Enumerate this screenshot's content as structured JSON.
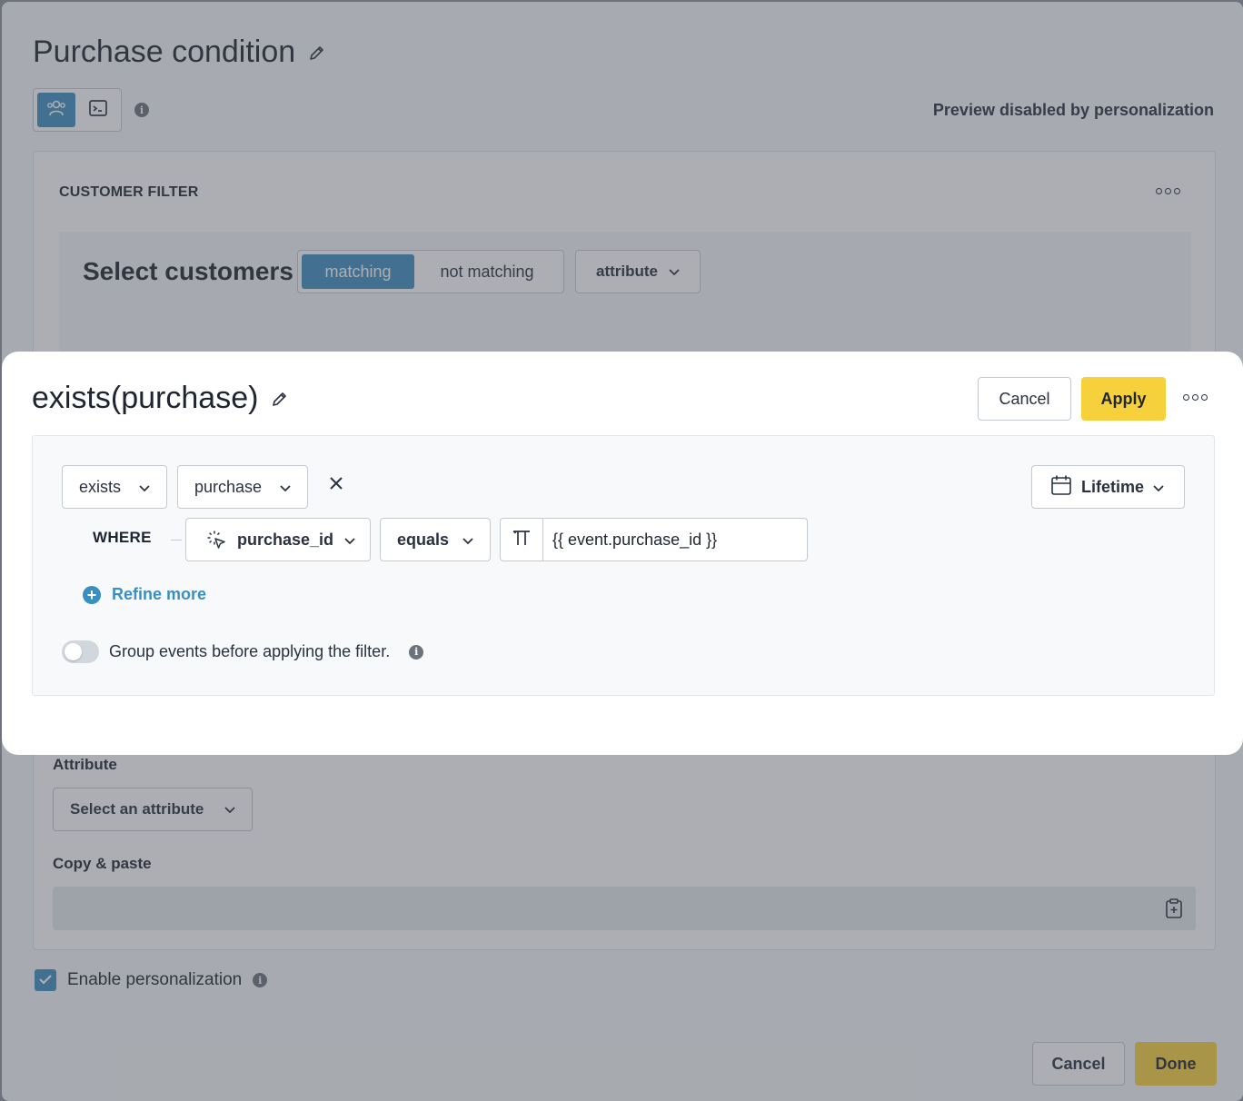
{
  "background_dialog": {
    "title": "Purchase condition",
    "preview_status": "Preview disabled by personalization",
    "customer_filter": {
      "label": "CUSTOMER FILTER",
      "heading": "Select customers",
      "segment": {
        "active": "matching",
        "inactive": "not matching"
      },
      "type_dropdown": "attribute"
    },
    "attribute": {
      "label": "Attribute",
      "select_placeholder": "Select an attribute"
    },
    "copy_paste": {
      "label": "Copy & paste",
      "value": ""
    },
    "enable_personalization": {
      "label": "Enable personalization",
      "checked": true
    },
    "buttons": {
      "cancel": "Cancel",
      "done": "Done"
    }
  },
  "modal": {
    "title": "exists(purchase)",
    "buttons": {
      "cancel": "Cancel",
      "apply": "Apply"
    },
    "rule": {
      "operator": "exists",
      "event": "purchase",
      "time_range": "Lifetime",
      "where_label": "WHERE",
      "property": "purchase_id",
      "comparison": "equals",
      "value": "{{ event.purchase_id }}"
    },
    "refine_more": "Refine more",
    "group_events": {
      "label": "Group events before applying the filter.",
      "enabled": false
    }
  },
  "colors": {
    "accent_blue": "#3f8fbf",
    "apply_yellow": "#f7d13c",
    "link_blue": "#3a8fc2"
  }
}
